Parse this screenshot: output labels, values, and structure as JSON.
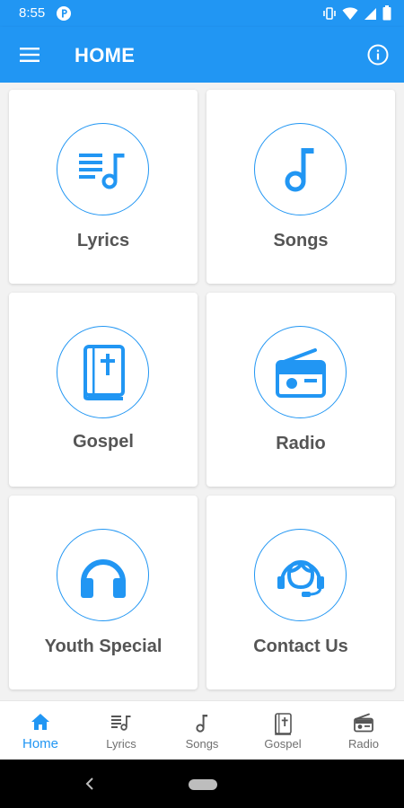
{
  "status_bar": {
    "time": "8:55"
  },
  "app_bar": {
    "title": "HOME"
  },
  "cards": [
    {
      "label": "Lyrics",
      "icon": "lyrics-icon"
    },
    {
      "label": "Songs",
      "icon": "music-note-icon"
    },
    {
      "label": "Gospel",
      "icon": "bible-icon"
    },
    {
      "label": "Radio",
      "icon": "radio-icon"
    },
    {
      "label": "Youth Special",
      "icon": "headphones-icon"
    },
    {
      "label": "Contact Us",
      "icon": "support-agent-icon"
    }
  ],
  "bottom_nav": {
    "items": [
      {
        "label": "Home",
        "icon": "home-icon",
        "active": true
      },
      {
        "label": "Lyrics",
        "icon": "lyrics-icon"
      },
      {
        "label": "Songs",
        "icon": "music-note-icon"
      },
      {
        "label": "Gospel",
        "icon": "bible-icon"
      },
      {
        "label": "Radio",
        "icon": "radio-icon"
      }
    ]
  },
  "colors": {
    "primary": "#2196f3",
    "label_text": "#555555",
    "background": "#f2f2f2"
  }
}
